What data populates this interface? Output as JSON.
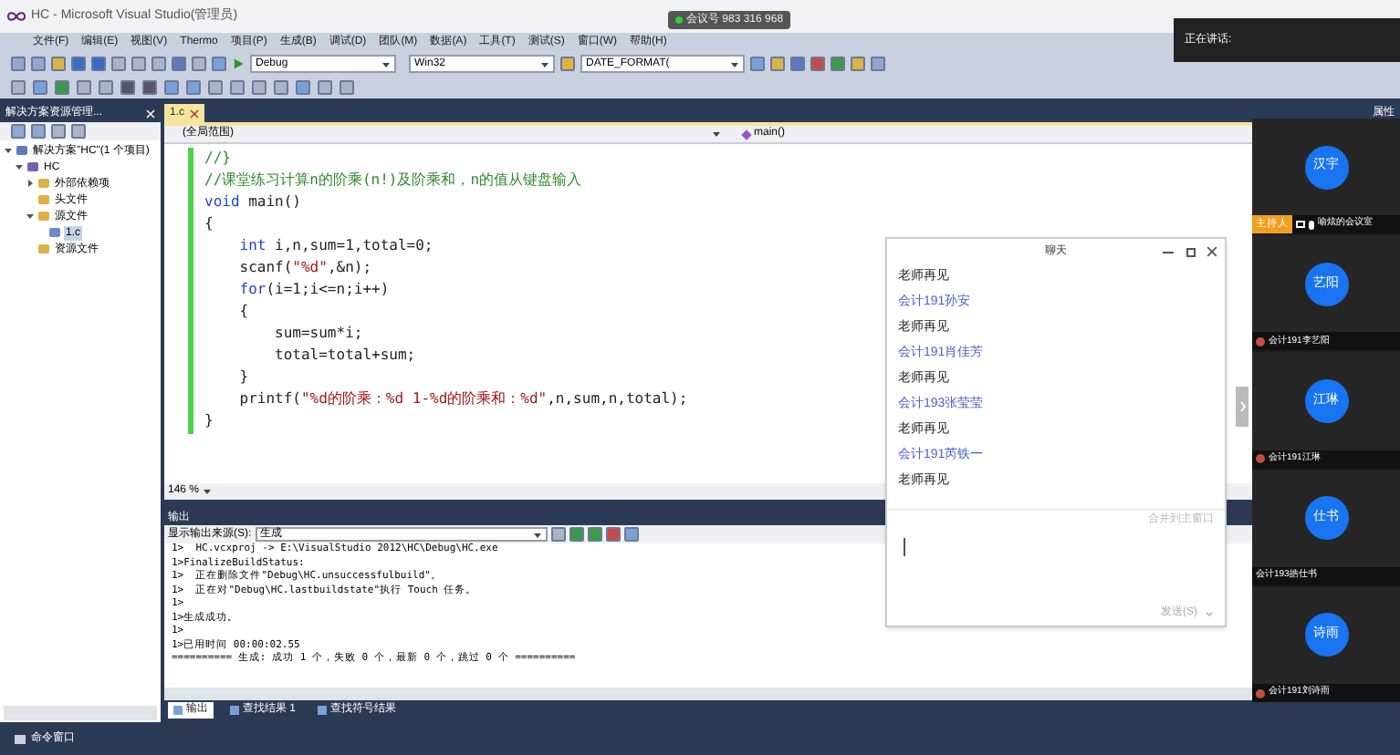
{
  "window": {
    "title": "HC - Microsoft Visual Studio(管理员)"
  },
  "meeting_badge": {
    "text": "会议号 983 316 968"
  },
  "speaking_tip": {
    "text": "正在讲话:"
  },
  "menu": [
    "文件(F)",
    "编辑(E)",
    "视图(V)",
    "Thermo",
    "项目(P)",
    "生成(B)",
    "调试(D)",
    "团队(M)",
    "数据(A)",
    "工具(T)",
    "测试(S)",
    "窗口(W)",
    "帮助(H)"
  ],
  "toolbar": {
    "configuration": "Debug",
    "platform": "Win32",
    "find": "DATE_FORMAT("
  },
  "solution_explorer": {
    "title": "解决方案资源管理...",
    "tree": [
      {
        "label": "解决方案\"HC\"(1 个项目)",
        "kind": "solution",
        "expanded": true,
        "selected": false,
        "children": [
          {
            "label": "HC",
            "kind": "project",
            "expanded": true,
            "selected": false,
            "children": [
              {
                "label": "外部依赖项",
                "kind": "folder",
                "expanded": false,
                "selected": false
              },
              {
                "label": "头文件",
                "kind": "folder",
                "selected": false
              },
              {
                "label": "源文件",
                "kind": "folder",
                "expanded": true,
                "selected": false,
                "children": [
                  {
                    "label": "1.c",
                    "kind": "file",
                    "selected": true
                  }
                ]
              },
              {
                "label": "资源文件",
                "kind": "folder",
                "selected": false
              }
            ]
          }
        ]
      }
    ]
  },
  "editor": {
    "tabs": [
      {
        "label": "1.c",
        "selected": true
      }
    ],
    "scope": "(全局范围)",
    "member": "main()",
    "right_panel_title": "属性",
    "zoom": "146 %",
    "lines": [
      [
        {
          "kind": "comment",
          "text": "//}"
        }
      ],
      [
        {
          "kind": "comment",
          "text": "//课堂练习计算n的阶乘(n!)及阶乘和，n的值从键盘输入"
        }
      ],
      [
        {
          "kind": "keyword",
          "text": "void"
        },
        {
          "kind": "plain",
          "text": " main()"
        }
      ],
      [
        {
          "kind": "plain",
          "text": "{"
        }
      ],
      [
        {
          "kind": "keyword",
          "text": "    int"
        },
        {
          "kind": "plain",
          "text": " i,n,sum=1,total=0;"
        }
      ],
      [
        {
          "kind": "plain",
          "text": "    scanf("
        },
        {
          "kind": "string",
          "text": "\"%d\""
        },
        {
          "kind": "plain",
          "text": ",&n);"
        }
      ],
      [
        {
          "kind": "keyword",
          "text": "    for"
        },
        {
          "kind": "plain",
          "text": "(i=1;i<=n;i++)"
        }
      ],
      [
        {
          "kind": "plain",
          "text": "    {"
        }
      ],
      [
        {
          "kind": "plain",
          "text": "        sum=sum*i;"
        }
      ],
      [
        {
          "kind": "plain",
          "text": "        total=total+sum;"
        }
      ],
      [
        {
          "kind": "plain",
          "text": "    }"
        }
      ],
      [
        {
          "kind": "plain",
          "text": "    printf("
        },
        {
          "kind": "string",
          "text": "\"%d的阶乘：%d 1-%d的阶乘和：%d\""
        },
        {
          "kind": "plain",
          "text": ",n,sum,n,total);"
        }
      ],
      [
        {
          "kind": "plain",
          "text": "}"
        }
      ]
    ]
  },
  "output": {
    "title": "输出",
    "source_label": "显示输出来源(S):",
    "source": "生成",
    "lines": [
      "1>  HC.vcxproj -> E:\\VisualStudio 2012\\HC\\Debug\\HC.exe",
      "1>FinalizeBuildStatus:",
      "1>  正在删除文件\"Debug\\HC.unsuccessfulbuild\"。",
      "1>  正在对\"Debug\\HC.lastbuildstate\"执行 Touch 任务。",
      "1>",
      "1>生成成功。",
      "1>",
      "1>已用时间 00:00:02.55",
      "========== 生成: 成功 1 个，失败 0 个，最新 0 个，跳过 0 个 =========="
    ],
    "tabs": [
      {
        "label": "输出",
        "selected": true
      },
      {
        "label": "查找结果 1",
        "selected": false
      },
      {
        "label": "查找符号结果",
        "selected": false
      }
    ]
  },
  "bottom_bar": {
    "label": "命令窗口"
  },
  "chat": {
    "title": "聊天",
    "messages": [
      {
        "kind": "text",
        "text": "老师再见"
      },
      {
        "kind": "sender",
        "text": "会计191孙安"
      },
      {
        "kind": "text",
        "text": "老师再见"
      },
      {
        "kind": "sender",
        "text": "会计191肖佳芳"
      },
      {
        "kind": "text",
        "text": "老师再见"
      },
      {
        "kind": "sender",
        "text": "会计193张莹莹"
      },
      {
        "kind": "text",
        "text": "老师再见"
      },
      {
        "kind": "sender",
        "text": "会计191芮铁一"
      },
      {
        "kind": "text",
        "text": "老师再见"
      }
    ],
    "merge_hint": "合并到主窗口",
    "send": "发送(S)"
  },
  "participants": [
    {
      "avatar": "汉宇",
      "name": "喻炫的会议室",
      "host_badge": "主持人",
      "kind": "host"
    },
    {
      "avatar": "艺阳",
      "name": "会计191李艺阳",
      "kind": "muted"
    },
    {
      "avatar": "江琳",
      "name": "会计191江琳",
      "kind": "muted"
    },
    {
      "avatar": "仕书",
      "name": "会计193皓仕书",
      "kind": "plain"
    },
    {
      "avatar": "诗雨",
      "name": "会计191刘诗雨",
      "kind": "muted"
    }
  ]
}
